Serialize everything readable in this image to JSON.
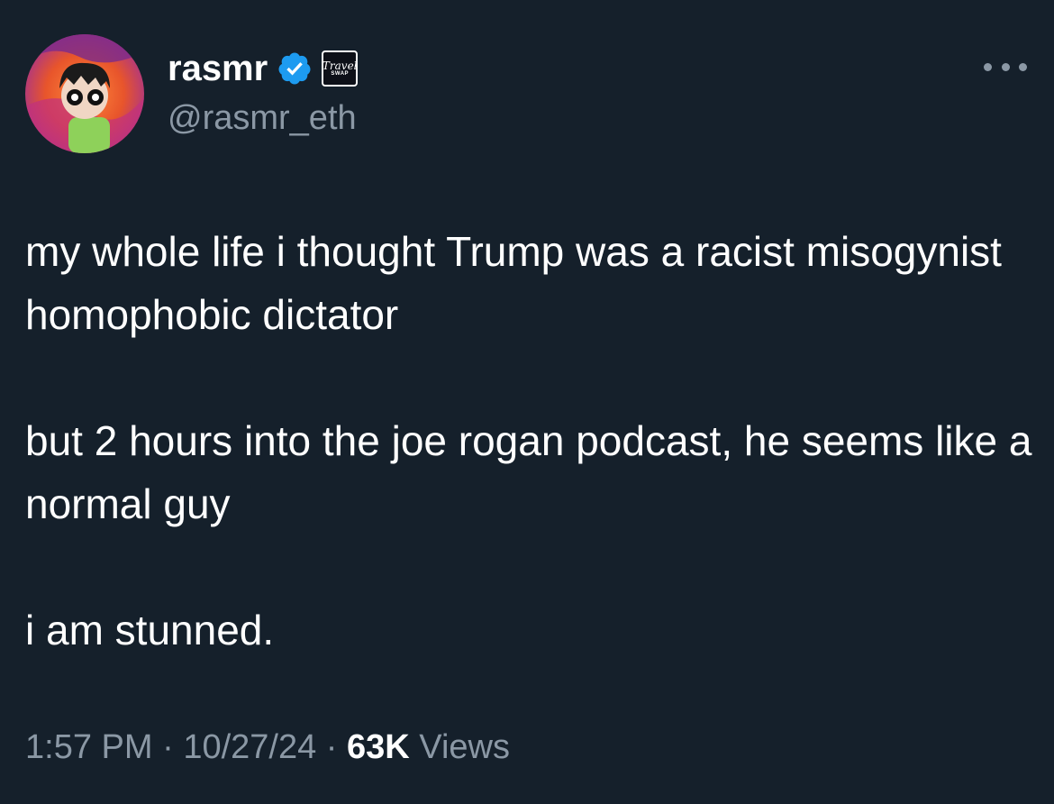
{
  "author": {
    "display_name": "rasmr",
    "handle": "@rasmr_eth",
    "verified_icon": "verified-badge-icon",
    "affiliate_badge": {
      "line1": "Travel",
      "line2": "SWAP"
    }
  },
  "tweet": {
    "paragraphs": [
      "my whole life i thought Trump was a racist misogynist homophobic dictator",
      "but 2 hours into the joe rogan podcast, he seems like a normal guy",
      "i am stunned."
    ]
  },
  "meta": {
    "time": "1:57 PM",
    "separator": " · ",
    "date": "10/27/24",
    "views_count": "63K",
    "views_label": " Views"
  },
  "colors": {
    "background": "#15202b",
    "text_primary": "#ffffff",
    "text_secondary": "#8b98a5",
    "verified_blue": "#1d9bf0"
  }
}
